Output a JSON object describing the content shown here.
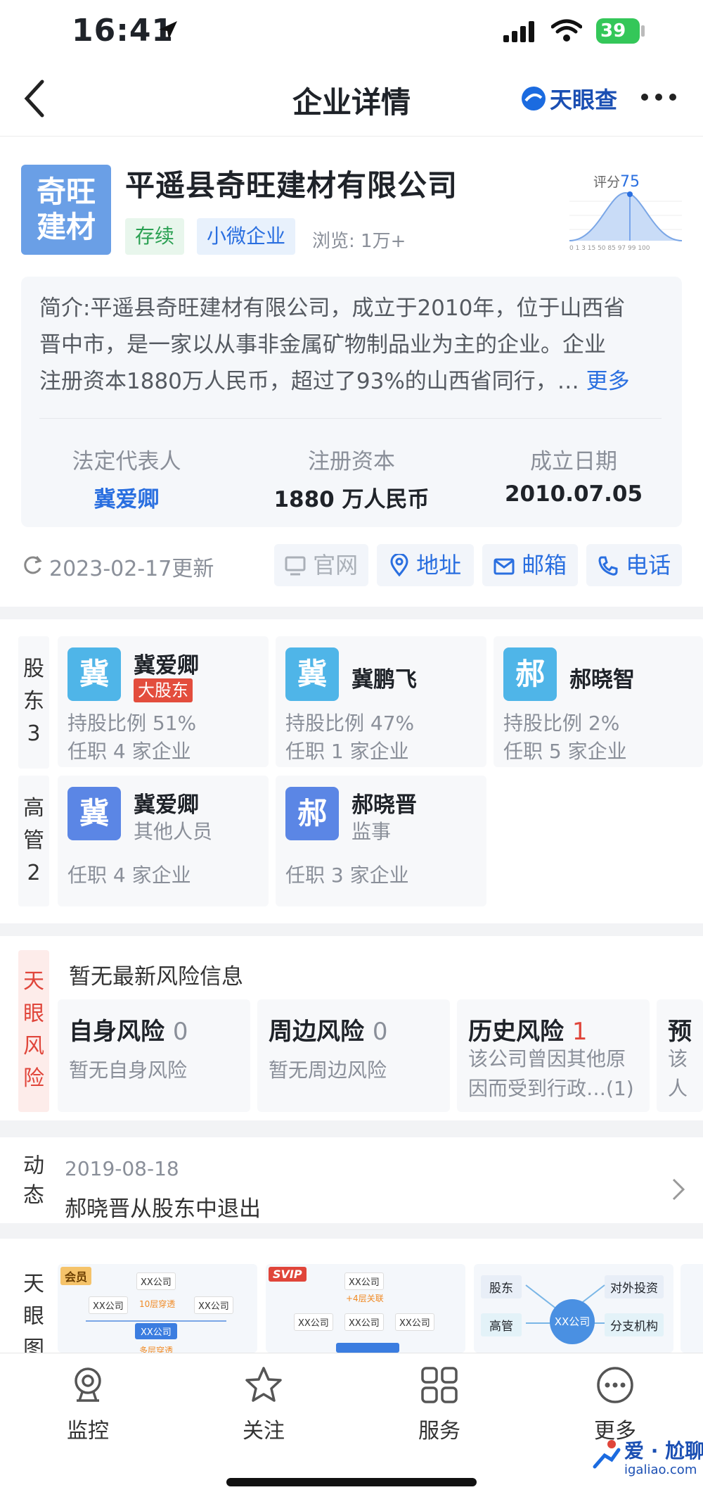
{
  "status_bar": {
    "time": "16:41",
    "battery": "39"
  },
  "nav": {
    "title": "企业详情",
    "brand": "天眼查"
  },
  "company": {
    "logo_line1": "奇旺",
    "logo_line2": "建材",
    "name": "平遥县奇旺建材有限公司",
    "status_tag": "存续",
    "scale_tag": "小微企业",
    "views": "浏览: 1万+",
    "score_label": "评分",
    "score_value": "75",
    "score_axis": "0 1 3 15 50 85 97 99 100"
  },
  "intro": {
    "line1": "简介:平遥县奇旺建材有限公司，成立于2010年，位于山西省",
    "line2": "晋中市，是一家以从事非金属矿物制品业为主的企业。企业",
    "line3": "注册资本1880万人民币，超过了93%的山西省同行，…",
    "more": "更多"
  },
  "basic_info": {
    "legal_rep_label": "法定代表人",
    "legal_rep_value": "冀爱卿",
    "capital_label": "注册资本",
    "capital_value": "1880 万人民币",
    "date_label": "成立日期",
    "date_value": "2010.07.05"
  },
  "update": {
    "text": "2023-02-17更新"
  },
  "actions": {
    "website": "官网",
    "address": "地址",
    "email": "邮箱",
    "phone": "电话"
  },
  "shareholders": {
    "label_lines": [
      "股",
      "东",
      "3"
    ],
    "items": [
      {
        "avatar": "冀",
        "name": "冀爱卿",
        "badge": "大股东",
        "ratio": "持股比例 51%",
        "positions": "任职 4 家企业",
        "color": "#4fb5e8"
      },
      {
        "avatar": "冀",
        "name": "冀鹏飞",
        "ratio": "持股比例 47%",
        "positions": "任职 1 家企业",
        "color": "#4fb5e8"
      },
      {
        "avatar": "郝",
        "name": "郝晓智",
        "ratio": "持股比例 2%",
        "positions": "任职 5 家企业",
        "color": "#4fb5e8"
      }
    ]
  },
  "executives": {
    "label_lines": [
      "高",
      "管",
      "2"
    ],
    "items": [
      {
        "avatar": "冀",
        "name": "冀爱卿",
        "role": "其他人员",
        "positions": "任职 4 家企业",
        "color": "#5b86e5"
      },
      {
        "avatar": "郝",
        "name": "郝晓晋",
        "role": "监事",
        "positions": "任职 3 家企业",
        "color": "#5b86e5"
      }
    ]
  },
  "risk": {
    "label_lines": [
      "天",
      "眼",
      "风",
      "险"
    ],
    "header": "暂无最新风险信息",
    "cards": [
      {
        "title": "自身风险",
        "count": "0",
        "desc1": "暂无自身风险",
        "desc2": ""
      },
      {
        "title": "周边风险",
        "count": "0",
        "desc1": "暂无周边风险",
        "desc2": ""
      },
      {
        "title": "历史风险",
        "count": "1",
        "desc1": "该公司曾因其他原",
        "desc2": "因而受到行政…(1)"
      },
      {
        "title": "预",
        "count": "",
        "desc1": "该",
        "desc2": "人"
      }
    ]
  },
  "news": {
    "label_lines": [
      "动",
      "态"
    ],
    "date": "2019-08-18",
    "text": "郝晓晋从股东中退出"
  },
  "graph": {
    "label_lines": [
      "天",
      "眼",
      "图"
    ],
    "card1_badge": "会员",
    "card1_center": "XX公司",
    "card1_chip": "XX公司",
    "card1_note1": "10层穿透",
    "card1_note2": "多层穿透",
    "card2_badge": "SVIP",
    "card2_chip": "XX公司",
    "card2_note": "+4层关联",
    "card3_items": [
      "股东",
      "对外投资",
      "高管",
      "分支机构"
    ],
    "card3_center": "XX公司"
  },
  "tabbar": {
    "monitor": "监控",
    "follow": "关注",
    "service": "服务",
    "more": "更多"
  },
  "watermark": {
    "brand": "爱 · 尬聊",
    "url": "igaliao.com"
  }
}
